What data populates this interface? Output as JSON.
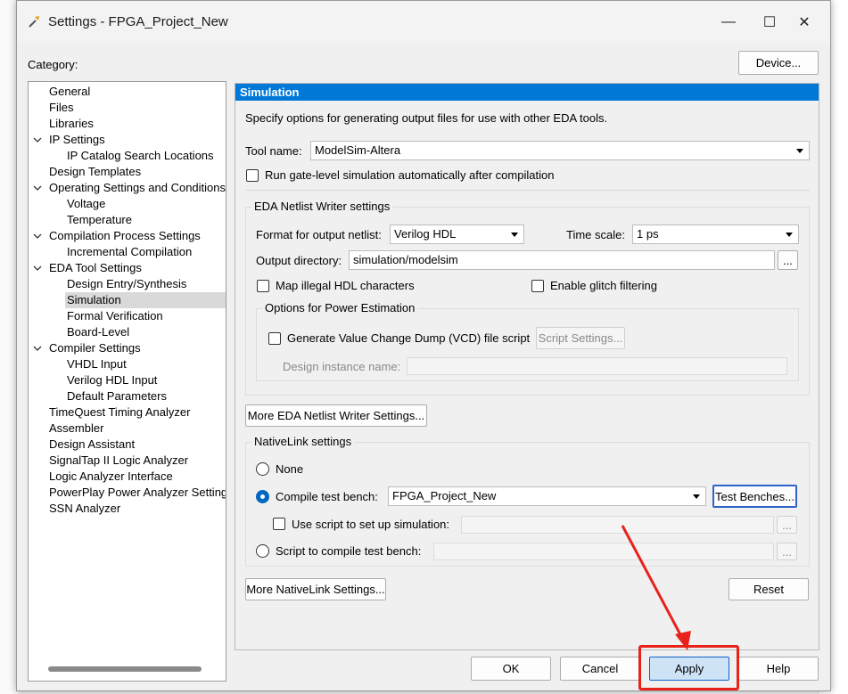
{
  "window": {
    "title": "Settings - FPGA_Project_New",
    "controls": {
      "minimize": "—",
      "maximize": "☐",
      "close": "✕"
    }
  },
  "category_label": "Category:",
  "device_button": "Device...",
  "tree": {
    "items": [
      {
        "label": "General",
        "level": 0,
        "expander": false
      },
      {
        "label": "Files",
        "level": 0,
        "expander": false
      },
      {
        "label": "Libraries",
        "level": 0,
        "expander": false
      },
      {
        "label": "IP Settings",
        "level": 0,
        "expander": true
      },
      {
        "label": "IP Catalog Search Locations",
        "level": 1,
        "expander": false
      },
      {
        "label": "Design Templates",
        "level": 0,
        "expander": false
      },
      {
        "label": "Operating Settings and Conditions",
        "level": 0,
        "expander": true
      },
      {
        "label": "Voltage",
        "level": 1,
        "expander": false
      },
      {
        "label": "Temperature",
        "level": 1,
        "expander": false
      },
      {
        "label": "Compilation Process Settings",
        "level": 0,
        "expander": true
      },
      {
        "label": "Incremental Compilation",
        "level": 1,
        "expander": false
      },
      {
        "label": "EDA Tool Settings",
        "level": 0,
        "expander": true
      },
      {
        "label": "Design Entry/Synthesis",
        "level": 1,
        "expander": false
      },
      {
        "label": "Simulation",
        "level": 1,
        "expander": false,
        "selected": true
      },
      {
        "label": "Formal Verification",
        "level": 1,
        "expander": false
      },
      {
        "label": "Board-Level",
        "level": 1,
        "expander": false
      },
      {
        "label": "Compiler Settings",
        "level": 0,
        "expander": true
      },
      {
        "label": "VHDL Input",
        "level": 1,
        "expander": false
      },
      {
        "label": "Verilog HDL Input",
        "level": 1,
        "expander": false
      },
      {
        "label": "Default Parameters",
        "level": 1,
        "expander": false
      },
      {
        "label": "TimeQuest Timing Analyzer",
        "level": 0,
        "expander": false
      },
      {
        "label": "Assembler",
        "level": 0,
        "expander": false
      },
      {
        "label": "Design Assistant",
        "level": 0,
        "expander": false
      },
      {
        "label": "SignalTap II Logic Analyzer",
        "level": 0,
        "expander": false
      },
      {
        "label": "Logic Analyzer Interface",
        "level": 0,
        "expander": false
      },
      {
        "label": "PowerPlay Power Analyzer Settings",
        "level": 0,
        "expander": false
      },
      {
        "label": "SSN Analyzer",
        "level": 0,
        "expander": false
      }
    ]
  },
  "panel": {
    "header": "Simulation",
    "description": "Specify options for generating output files for use with other EDA tools.",
    "tool_name_label": "Tool name:",
    "tool_name_value": "ModelSim-Altera",
    "run_gate_level": "Run gate-level simulation automatically after compilation",
    "eda_netlist": {
      "title": "EDA Netlist Writer settings",
      "format_label": "Format for output netlist:",
      "format_value": "Verilog HDL",
      "time_scale_label": "Time scale:",
      "time_scale_value": "1 ps",
      "output_dir_label": "Output directory:",
      "output_dir_value": "simulation/modelsim",
      "browse": "...",
      "map_illegal": "Map illegal HDL characters",
      "glitch": "Enable glitch filtering",
      "power": {
        "title": "Options for Power Estimation",
        "vcd": "Generate Value Change Dump (VCD) file script",
        "script_settings": "Script Settings...",
        "instance_label": "Design instance name:"
      }
    },
    "more_eda": "More EDA Netlist Writer Settings...",
    "nativelink": {
      "title": "NativeLink settings",
      "none": "None",
      "compile_tb": "Compile test bench:",
      "compile_tb_value": "FPGA_Project_New",
      "test_benches": "Test Benches...",
      "use_script": "Use script to set up simulation:",
      "script_compile": "Script to compile test bench:",
      "browse": "..."
    },
    "more_nativelink": "More NativeLink Settings...",
    "reset": "Reset"
  },
  "footer": {
    "ok": "OK",
    "cancel": "Cancel",
    "apply": "Apply",
    "help": "Help"
  },
  "colors": {
    "accent": "#0078d7",
    "annotation": "#e8221b"
  }
}
